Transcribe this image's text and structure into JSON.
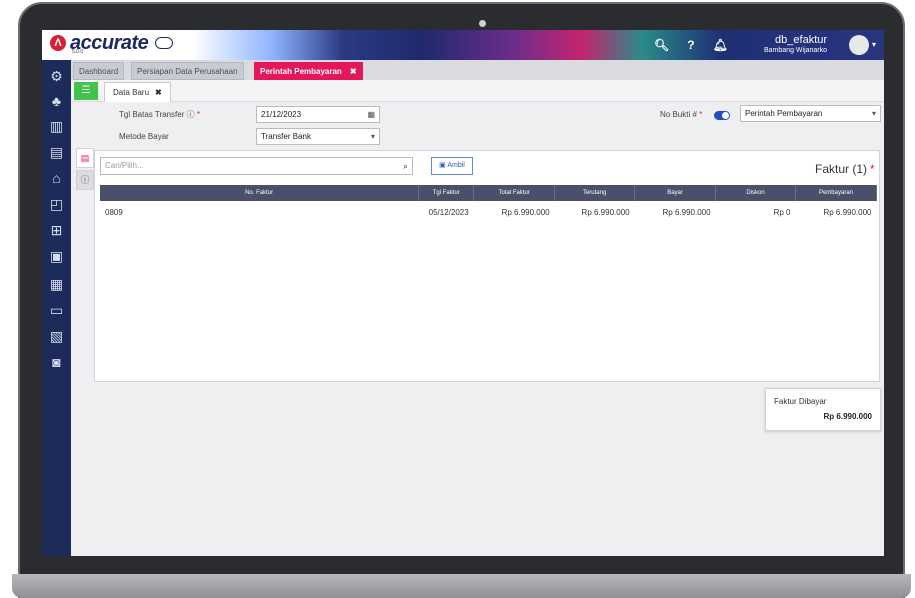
{
  "app": {
    "brand": "accurate",
    "version": "5.0.0",
    "db_name": "db_efaktur",
    "user_name": "Bambang Wijanarko"
  },
  "top_icons": [
    "search-icon",
    "help-icon",
    "bell-icon"
  ],
  "sidebar_icons": [
    "gear-icon",
    "org-icon",
    "building-icon",
    "book-icon",
    "bank-icon",
    "wallet-icon",
    "cart-icon",
    "truck-icon",
    "chart-icon",
    "card-icon",
    "report-icon",
    "doc-icon"
  ],
  "tabs": [
    {
      "label": "Dashboard"
    },
    {
      "label": "Persiapan Data Perusahaan"
    },
    {
      "label": "Perintah Pembayaran",
      "close": "✖"
    }
  ],
  "subtab": {
    "label": "Data Baru",
    "close": "✖"
  },
  "form": {
    "tgl_batas_label": "Tgl Batas Transfer ⓘ",
    "tgl_batas_value": "21/12/2023",
    "metode_label": "Metode Bayar",
    "metode_value": "Transfer Bank",
    "no_bukti_label": "No Bukti #",
    "type_value": "Perintah Pembayaran",
    "required_mark": "*"
  },
  "panel": {
    "search_placeholder": "Cari/Pilih...",
    "ambil_label": "Ambil",
    "title": "Faktur (1)",
    "title_required": "*"
  },
  "table": {
    "headers": [
      "No. Faktur",
      "Tgl Faktur",
      "Total Faktur",
      "Terutang",
      "Bayar",
      "Diskon",
      "Pembayaran"
    ],
    "rows": [
      {
        "no": "0809",
        "tgl": "05/12/2023",
        "total": "Rp 6.990.000",
        "terutang": "Rp 6.990.000",
        "bayar": "Rp 6.990.000",
        "diskon": "Rp 0",
        "pembayaran": "Rp 6.990.000"
      }
    ]
  },
  "summary": {
    "label": "Faktur Dibayar",
    "value": "Rp 6.990.000"
  },
  "colors": {
    "accent": "#e4175a",
    "sidebar": "#1c2b59",
    "header_row": "#4a5069",
    "green": "#43c34a"
  }
}
